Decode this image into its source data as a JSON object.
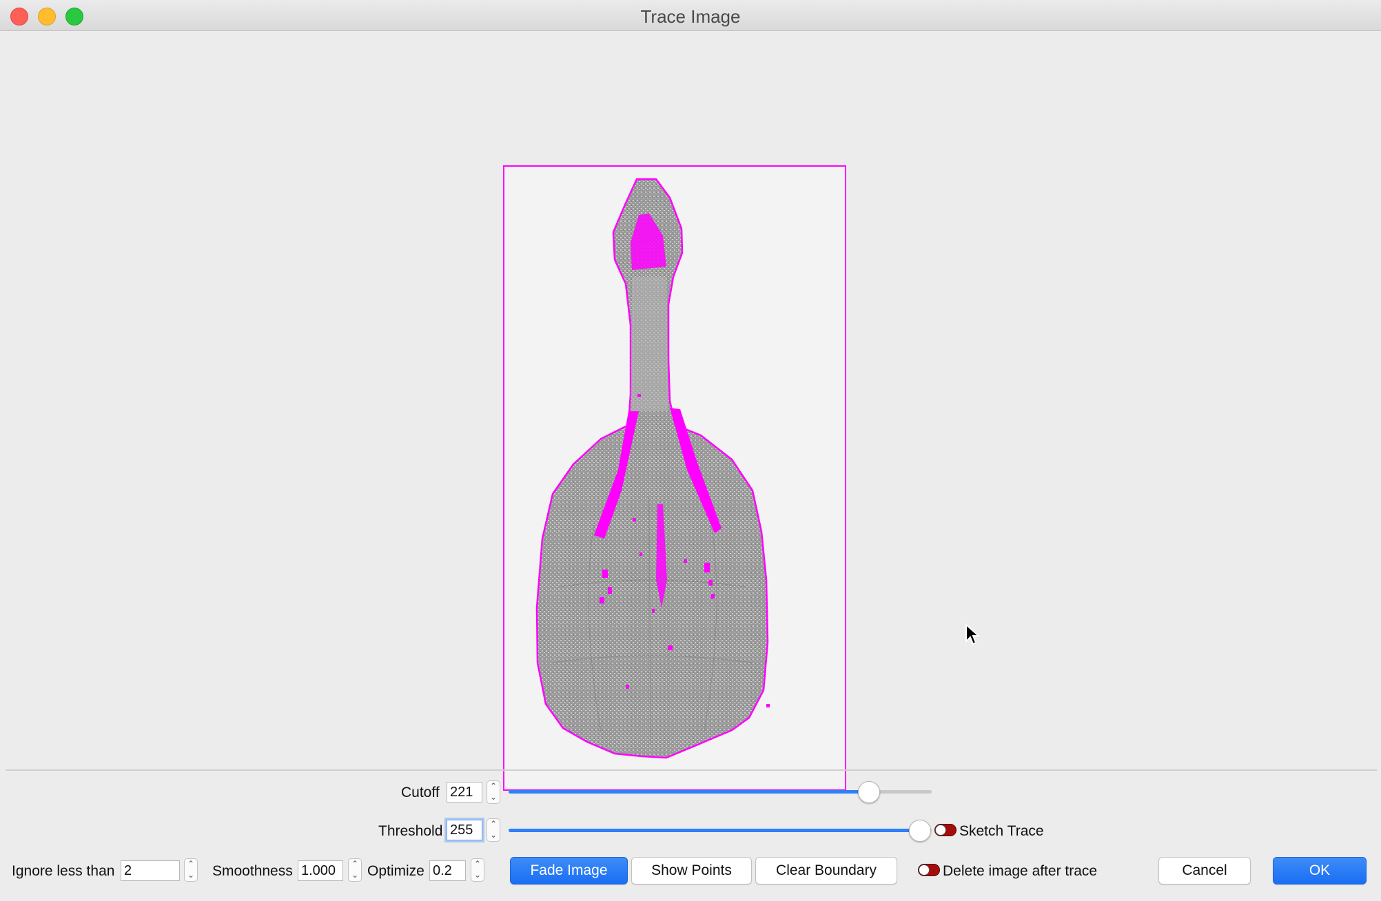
{
  "window": {
    "title": "Trace Image"
  },
  "cutoff": {
    "label": "Cutoff",
    "value": "221",
    "level": 0.85
  },
  "threshold": {
    "label": "Threshold",
    "value": "255",
    "level": 1.0
  },
  "sketch_trace": {
    "label": "Sketch Trace",
    "checked": false
  },
  "ignore": {
    "label": "Ignore less than",
    "value": "2"
  },
  "smoothness": {
    "label": "Smoothness",
    "value": "1.000"
  },
  "optimize": {
    "label": "Optimize",
    "value": "0.2"
  },
  "buttons": {
    "fade": "Fade Image",
    "show_points": "Show Points",
    "clear_boundary": "Clear Boundary",
    "cancel": "Cancel",
    "ok": "OK"
  },
  "delete_after": {
    "label": "Delete image after trace",
    "checked": false
  },
  "colors": {
    "trace": "#ff00ff",
    "accent": "#1a6ef3",
    "toggle_off": "#a50d0d"
  }
}
